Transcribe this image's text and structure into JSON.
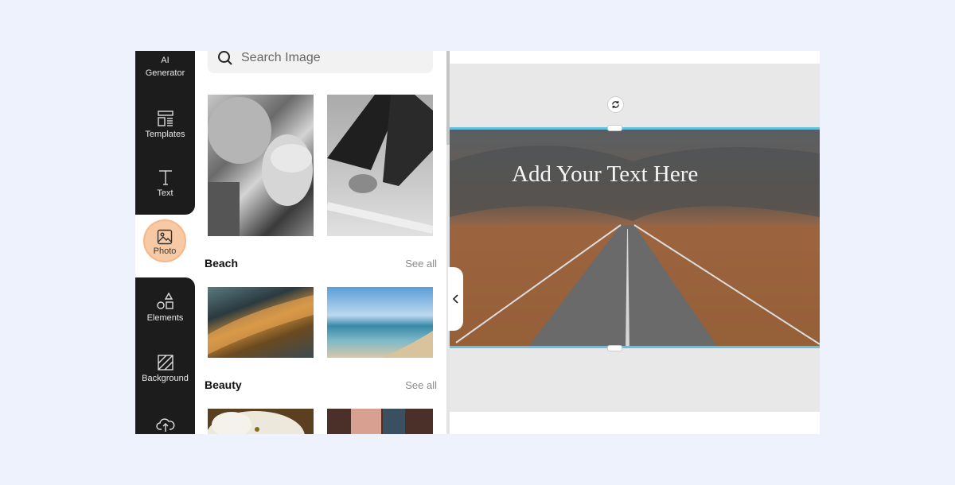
{
  "sidebar": {
    "items": [
      {
        "label": "AI\nGenerator",
        "icon": "ai-generator-icon"
      },
      {
        "label": "Templates",
        "icon": "templates-icon"
      },
      {
        "label": "Text",
        "icon": "text-icon"
      },
      {
        "label": "Photo",
        "icon": "photo-icon",
        "active": true
      },
      {
        "label": "Elements",
        "icon": "elements-icon"
      },
      {
        "label": "Background",
        "icon": "background-icon"
      },
      {
        "label": "Upload",
        "icon": "upload-cloud-icon"
      }
    ],
    "ai_label_1": "AI",
    "ai_label_2": "Generator",
    "active_color": "#f8c9a5"
  },
  "panel": {
    "search_placeholder": "Search Image",
    "sections": [
      {
        "title": "Beach",
        "see_all": "See all"
      },
      {
        "title": "Beauty",
        "see_all": "See all"
      }
    ]
  },
  "canvas": {
    "text": "Add Your Text Here",
    "selection_color": "#62c3e0"
  }
}
